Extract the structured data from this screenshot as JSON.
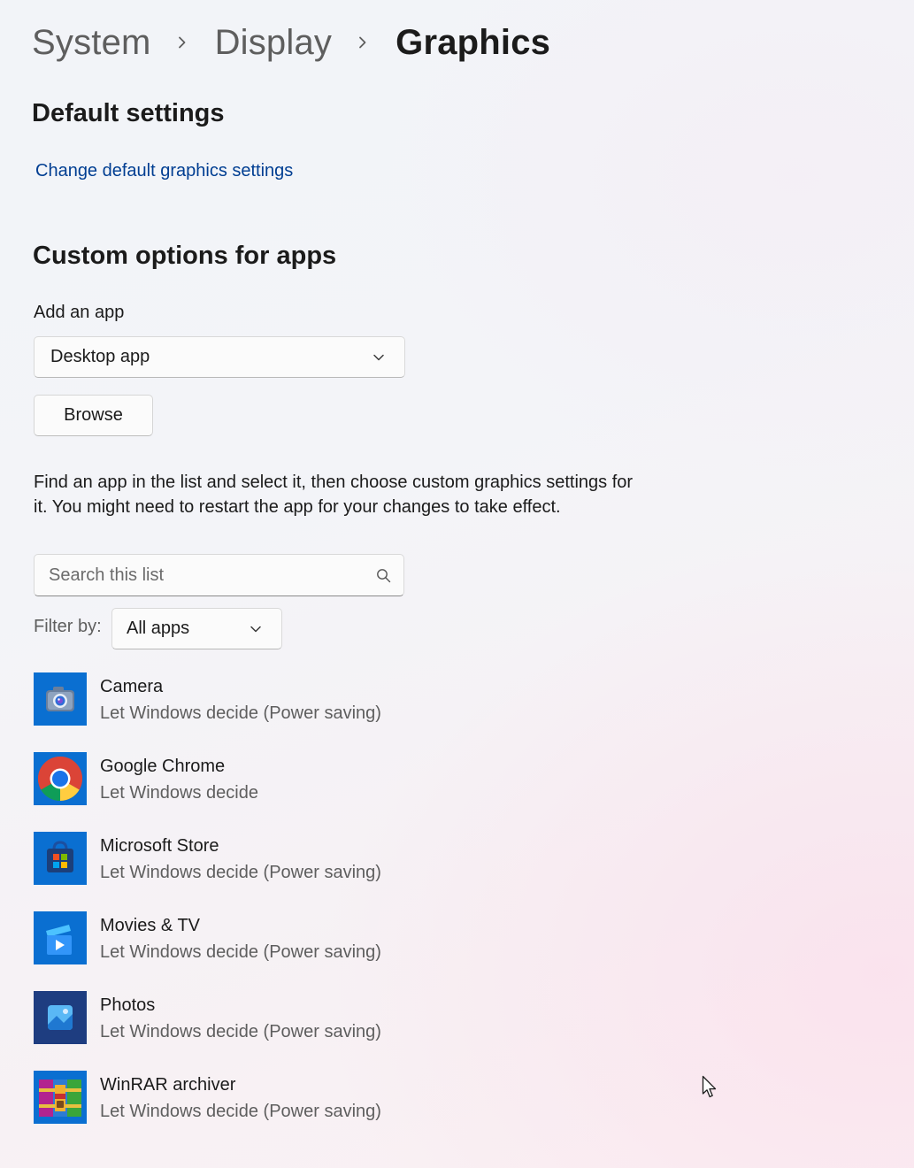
{
  "breadcrumb": {
    "items": [
      "System",
      "Display"
    ],
    "current": "Graphics"
  },
  "default_settings": {
    "heading": "Default settings",
    "link": "Change default graphics settings"
  },
  "custom": {
    "heading": "Custom options for apps",
    "add_app_label": "Add an app",
    "app_type_selected": "Desktop app",
    "browse_label": "Browse",
    "description": "Find an app in the list and select it, then choose custom graphics settings for it. You might need to restart the app for your changes to take effect.",
    "search_placeholder": "Search this list",
    "filter_label": "Filter by:",
    "filter_selected": "All apps"
  },
  "apps": [
    {
      "name": "Camera",
      "status": "Let Windows decide (Power saving)",
      "icon": "camera-icon"
    },
    {
      "name": "Google Chrome",
      "status": "Let Windows decide",
      "icon": "chrome-icon"
    },
    {
      "name": "Microsoft Store",
      "status": "Let Windows decide (Power saving)",
      "icon": "store-icon"
    },
    {
      "name": "Movies & TV",
      "status": "Let Windows decide (Power saving)",
      "icon": "movies-icon"
    },
    {
      "name": "Photos",
      "status": "Let Windows decide (Power saving)",
      "icon": "photos-icon"
    },
    {
      "name": "WinRAR archiver",
      "status": "Let Windows decide (Power saving)",
      "icon": "winrar-icon"
    }
  ],
  "colors": {
    "link": "#003e92",
    "camera_bg": "#0a6fd1",
    "chrome_bg": "#0a6fd1",
    "store_bg": "#0a6fd1",
    "movies_bg": "#0a6fd1",
    "photos_bg": "#1e3d80",
    "winrar_bg": "#0a6fd1"
  }
}
